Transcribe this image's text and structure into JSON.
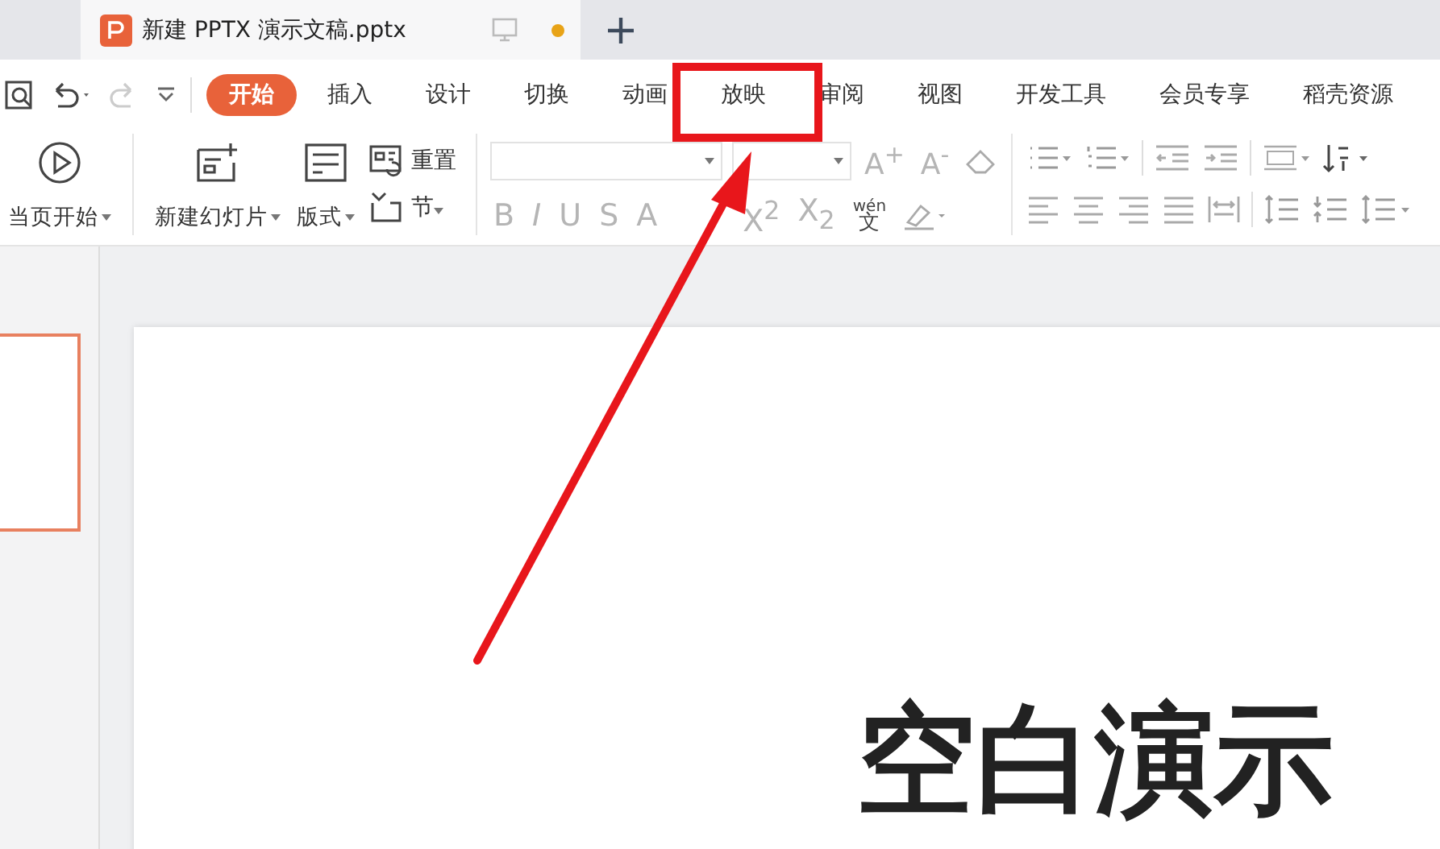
{
  "document_tab": {
    "title": "新建 PPTX 演示文稿.pptx",
    "unsaved": true
  },
  "menu": [
    {
      "label": "开始",
      "selected": true
    },
    {
      "label": "插入",
      "selected": false
    },
    {
      "label": "设计",
      "selected": false
    },
    {
      "label": "切换",
      "selected": false
    },
    {
      "label": "动画",
      "selected": false
    },
    {
      "label": "放映",
      "selected": false
    },
    {
      "label": "审阅",
      "selected": false
    },
    {
      "label": "视图",
      "selected": false
    },
    {
      "label": "开发工具",
      "selected": false
    },
    {
      "label": "会员专享",
      "selected": false
    },
    {
      "label": "稻壳资源",
      "selected": false
    }
  ],
  "ribbon": {
    "play_label": "当页开始",
    "new_slide_label": "新建幻灯片",
    "layout_label": "版式",
    "reset_label": "重置",
    "section_label": "节",
    "font_size_buttons": [
      "A$^{+}$",
      "A$^{-}$"
    ],
    "format_buttons": [
      "B",
      "*I*",
      "U",
      "S",
      "A",
      "X$^{2}$",
      "X$_{2}$"
    ],
    "phonetic_button": {
      "pinyin": "wén",
      "character": "文"
    }
  },
  "thumbnails": [
    {
      "selected": true
    }
  ],
  "slide": {
    "title": "空白演示"
  }
}
